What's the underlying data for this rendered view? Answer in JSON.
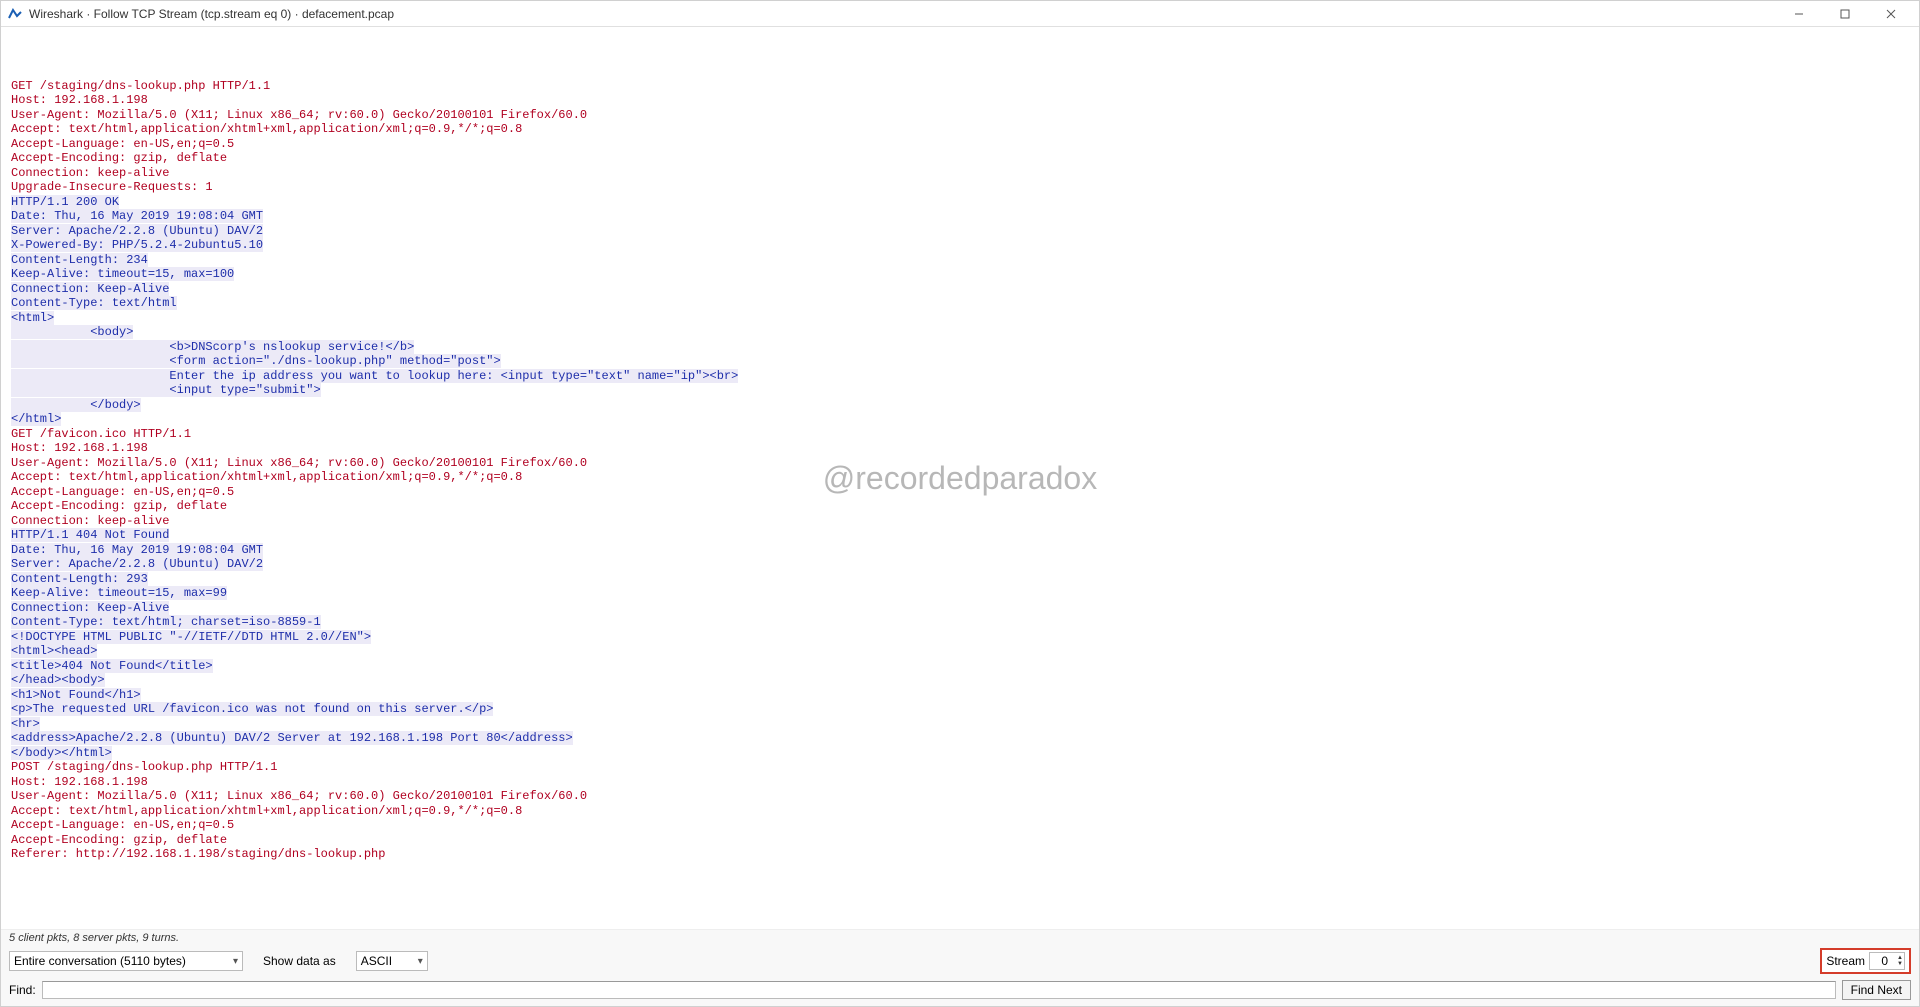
{
  "window": {
    "title": "Wireshark · Follow TCP Stream (tcp.stream eq 0) · defacement.pcap"
  },
  "watermark": "@recordedparadox",
  "status": {
    "client_pkts_count": "5",
    "client_label": "client",
    "pkts_word": "pkts,",
    "server_pkts_count": "8",
    "server_label": "server",
    "turns": "9 turns."
  },
  "controls": {
    "conversation_dropdown": "Entire conversation (5110 bytes)",
    "show_data_as_label": "Show data as",
    "encoding_dropdown": "ASCII",
    "stream_label": "Stream",
    "stream_value": "0"
  },
  "find": {
    "label": "Find:",
    "value": "",
    "find_next_label": "Find Next"
  },
  "stream": [
    {
      "c": "client",
      "t": "GET /staging/dns-lookup.php HTTP/1.1"
    },
    {
      "c": "client",
      "t": "Host: 192.168.1.198"
    },
    {
      "c": "client",
      "t": "User-Agent: Mozilla/5.0 (X11; Linux x86_64; rv:60.0) Gecko/20100101 Firefox/60.0"
    },
    {
      "c": "client",
      "t": "Accept: text/html,application/xhtml+xml,application/xml;q=0.9,*/*;q=0.8"
    },
    {
      "c": "client",
      "t": "Accept-Language: en-US,en;q=0.5"
    },
    {
      "c": "client",
      "t": "Accept-Encoding: gzip, deflate"
    },
    {
      "c": "client",
      "t": "Connection: keep-alive"
    },
    {
      "c": "client",
      "t": "Upgrade-Insecure-Requests: 1"
    },
    {
      "c": "client",
      "t": ""
    },
    {
      "c": "server",
      "t": "HTTP/1.1 200 OK"
    },
    {
      "c": "server",
      "t": "Date: Thu, 16 May 2019 19:08:04 GMT"
    },
    {
      "c": "server",
      "t": "Server: Apache/2.2.8 (Ubuntu) DAV/2"
    },
    {
      "c": "server",
      "t": "X-Powered-By: PHP/5.2.4-2ubuntu5.10"
    },
    {
      "c": "server",
      "t": "Content-Length: 234"
    },
    {
      "c": "server",
      "t": "Keep-Alive: timeout=15, max=100"
    },
    {
      "c": "server",
      "t": "Connection: Keep-Alive"
    },
    {
      "c": "server",
      "t": "Content-Type: text/html"
    },
    {
      "c": "server",
      "t": ""
    },
    {
      "c": "server",
      "t": ""
    },
    {
      "c": "server",
      "t": "<html>"
    },
    {
      "c": "server",
      "t": "           <body>"
    },
    {
      "c": "server",
      "t": "                      <b>DNScorp's nslookup service!</b>"
    },
    {
      "c": "server",
      "t": "                      <form action=\"./dns-lookup.php\" method=\"post\">"
    },
    {
      "c": "server",
      "t": "                      Enter the ip address you want to lookup here: <input type=\"text\" name=\"ip\"><br>"
    },
    {
      "c": "server",
      "t": "                      <input type=\"submit\">"
    },
    {
      "c": "server",
      "t": "           </body>"
    },
    {
      "c": "server",
      "t": "</html>"
    },
    {
      "c": "client",
      "t": "GET /favicon.ico HTTP/1.1"
    },
    {
      "c": "client",
      "t": "Host: 192.168.1.198"
    },
    {
      "c": "client",
      "t": "User-Agent: Mozilla/5.0 (X11; Linux x86_64; rv:60.0) Gecko/20100101 Firefox/60.0"
    },
    {
      "c": "client",
      "t": "Accept: text/html,application/xhtml+xml,application/xml;q=0.9,*/*;q=0.8"
    },
    {
      "c": "client",
      "t": "Accept-Language: en-US,en;q=0.5"
    },
    {
      "c": "client",
      "t": "Accept-Encoding: gzip, deflate"
    },
    {
      "c": "client",
      "t": "Connection: keep-alive"
    },
    {
      "c": "client",
      "t": ""
    },
    {
      "c": "server",
      "t": "HTTP/1.1 404 Not Found"
    },
    {
      "c": "server",
      "t": "Date: Thu, 16 May 2019 19:08:04 GMT"
    },
    {
      "c": "server",
      "t": "Server: Apache/2.2.8 (Ubuntu) DAV/2"
    },
    {
      "c": "server",
      "t": "Content-Length: 293"
    },
    {
      "c": "server",
      "t": "Keep-Alive: timeout=15, max=99"
    },
    {
      "c": "server",
      "t": "Connection: Keep-Alive"
    },
    {
      "c": "server",
      "t": "Content-Type: text/html; charset=iso-8859-1"
    },
    {
      "c": "server",
      "t": ""
    },
    {
      "c": "server",
      "t": "<!DOCTYPE HTML PUBLIC \"-//IETF//DTD HTML 2.0//EN\">"
    },
    {
      "c": "server",
      "t": "<html><head>"
    },
    {
      "c": "server",
      "t": "<title>404 Not Found</title>"
    },
    {
      "c": "server",
      "t": "</head><body>"
    },
    {
      "c": "server",
      "t": "<h1>Not Found</h1>"
    },
    {
      "c": "server",
      "t": "<p>The requested URL /favicon.ico was not found on this server.</p>"
    },
    {
      "c": "server",
      "t": "<hr>"
    },
    {
      "c": "server",
      "t": "<address>Apache/2.2.8 (Ubuntu) DAV/2 Server at 192.168.1.198 Port 80</address>"
    },
    {
      "c": "server",
      "t": "</body></html>"
    },
    {
      "c": "client",
      "t": "POST /staging/dns-lookup.php HTTP/1.1"
    },
    {
      "c": "client",
      "t": "Host: 192.168.1.198"
    },
    {
      "c": "client",
      "t": "User-Agent: Mozilla/5.0 (X11; Linux x86_64; rv:60.0) Gecko/20100101 Firefox/60.0"
    },
    {
      "c": "client",
      "t": "Accept: text/html,application/xhtml+xml,application/xml;q=0.9,*/*;q=0.8"
    },
    {
      "c": "client",
      "t": "Accept-Language: en-US,en;q=0.5"
    },
    {
      "c": "client",
      "t": "Accept-Encoding: gzip, deflate"
    },
    {
      "c": "client",
      "t": "Referer: http://192.168.1.198/staging/dns-lookup.php"
    }
  ]
}
